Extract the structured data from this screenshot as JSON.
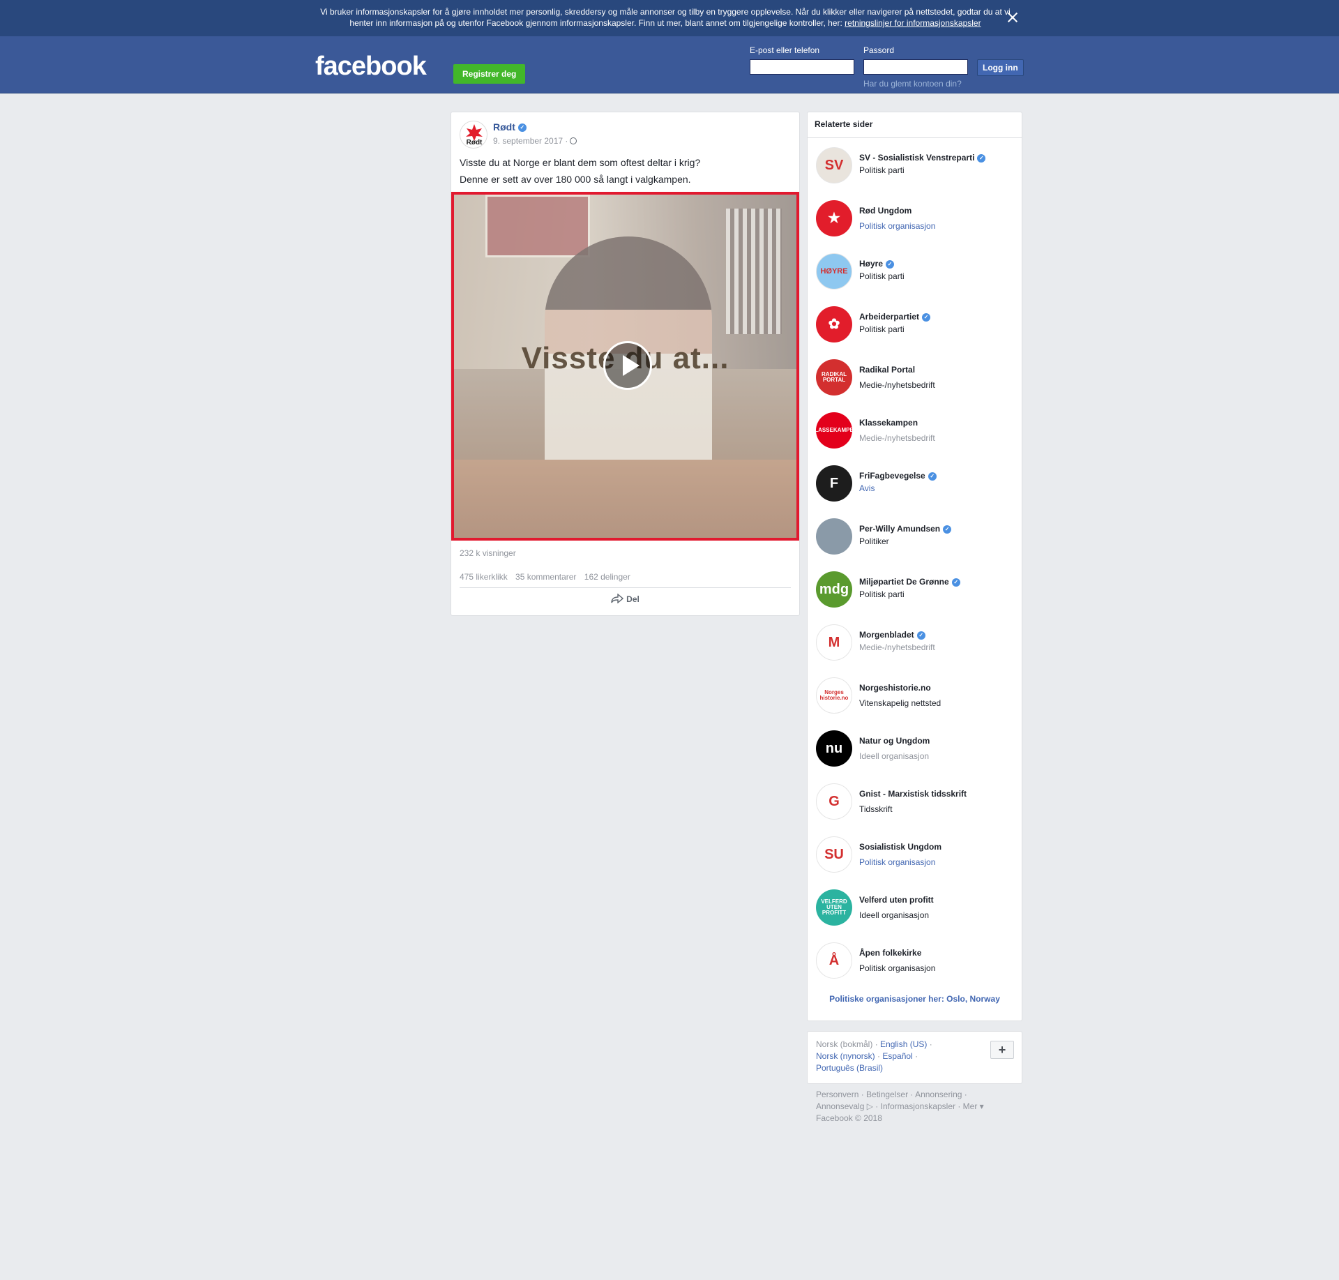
{
  "cookie_banner": {
    "text": "Vi bruker informasjonskapsler for å gjøre innholdet mer personlig, skreddersy og måle annonser og tilby en tryggere opplevelse. Når du klikker eller navigerer på nettstedet, godtar du at vi henter inn informasjon på og utenfor Facebook gjennom informasjonskapsler. Finn ut mer, blant annet om tilgjengelige kontroller, her: ",
    "link": "retningslinjer for informasjonskapsler"
  },
  "header": {
    "logo": "facebook",
    "register_label": "Registrer deg",
    "email_label": "E-post eller telefon",
    "password_label": "Passord",
    "login_label": "Logg inn",
    "forgot_label": "Har du glemt kontoen din?"
  },
  "post": {
    "author": "Rødt",
    "avatar_text": "Rødt",
    "date": "9. september 2017 ·",
    "text_line1": "Visste du at Norge er blant dem som oftest deltar i krig?",
    "text_line2": "Denne er sett av over 180 000 så langt i valgkampen.",
    "video_title": "Visste du at...",
    "views": "232 k visninger",
    "likes": "475 likerklikk",
    "comments": "35 kommentarer",
    "shares": "162 delinger",
    "share_label": "Del"
  },
  "related": {
    "title": "Relaterte sider",
    "items": [
      {
        "name": "SV - Sosialistisk Venstreparti",
        "category": "Politisk parti",
        "verified": true,
        "style": "",
        "avatar": "SV",
        "color": "#e9e4dd"
      },
      {
        "name": "Rød Ungdom",
        "category": "Politisk organisasjon",
        "verified": false,
        "style": "link",
        "avatar": "★",
        "color": "#e21d2b"
      },
      {
        "name": "Høyre",
        "category": "Politisk parti",
        "verified": true,
        "style": "",
        "avatar": "HØYRE",
        "color": "#8ec8f0"
      },
      {
        "name": "Arbeiderpartiet",
        "category": "Politisk parti",
        "verified": true,
        "style": "",
        "avatar": "✿",
        "color": "#e21d2b"
      },
      {
        "name": "Radikal Portal",
        "category": "Medie-/nyhetsbedrift",
        "verified": false,
        "style": "",
        "avatar": "RADIKAL PORTAL",
        "color": "#d32f2f"
      },
      {
        "name": "Klassekampen",
        "category": "Medie-/nyhetsbedrift",
        "verified": false,
        "style": "muted",
        "avatar": "KLASSEKAMPEN",
        "color": "#e3001b"
      },
      {
        "name": "FriFagbevegelse",
        "category": "Avis",
        "verified": true,
        "style": "link",
        "avatar": "F",
        "color": "#1d1d1d"
      },
      {
        "name": "Per-Willy Amundsen",
        "category": "Politiker",
        "verified": true,
        "style": "",
        "avatar": "",
        "color": "#8a9aa8"
      },
      {
        "name": "Miljøpartiet De Grønne",
        "category": "Politisk parti",
        "verified": true,
        "style": "",
        "avatar": "mdg",
        "color": "#5a9a2e"
      },
      {
        "name": "Morgenbladet",
        "category": "Medie-/nyhetsbedrift",
        "verified": true,
        "style": "muted",
        "avatar": "M",
        "color": "#ffffff"
      },
      {
        "name": "Norgeshistorie.no",
        "category": "Vitenskapelig nettsted",
        "verified": false,
        "style": "",
        "avatar": "Norges historie.no",
        "color": "#ffffff"
      },
      {
        "name": "Natur og Ungdom",
        "category": "Ideell organisasjon",
        "verified": false,
        "style": "muted",
        "avatar": "nu",
        "color": "#000000"
      },
      {
        "name": "Gnist - Marxistisk tidsskrift",
        "category": "Tidsskrift",
        "verified": false,
        "style": "",
        "avatar": "G",
        "color": "#ffffff"
      },
      {
        "name": "Sosialistisk Ungdom",
        "category": "Politisk organisasjon",
        "verified": false,
        "style": "link",
        "avatar": "SU",
        "color": "#ffffff"
      },
      {
        "name": "Velferd uten profitt",
        "category": "Ideell organisasjon",
        "verified": false,
        "style": "",
        "avatar": "VELFERD UTEN PROFITT",
        "color": "#2bb3a0"
      },
      {
        "name": "Åpen folkekirke",
        "category": "Politisk organisasjon",
        "verified": false,
        "style": "",
        "avatar": "Å",
        "color": "#ffffff"
      }
    ],
    "footer": "Politiske organisasjoner her: Oslo, Norway"
  },
  "languages": {
    "current": "Norsk (bokmål)",
    "english": "English (US)",
    "nynorsk": "Norsk (nynorsk)",
    "espanol": "Español",
    "portugues": "Português (Brasil)",
    "more": "+"
  },
  "footer": {
    "line1": "Personvern · Betingelser · Annonsering ·",
    "line2": "Annonsevalg ▷ · Informasjonskapsler · Mer ▾",
    "copyright": "Facebook © 2018"
  }
}
